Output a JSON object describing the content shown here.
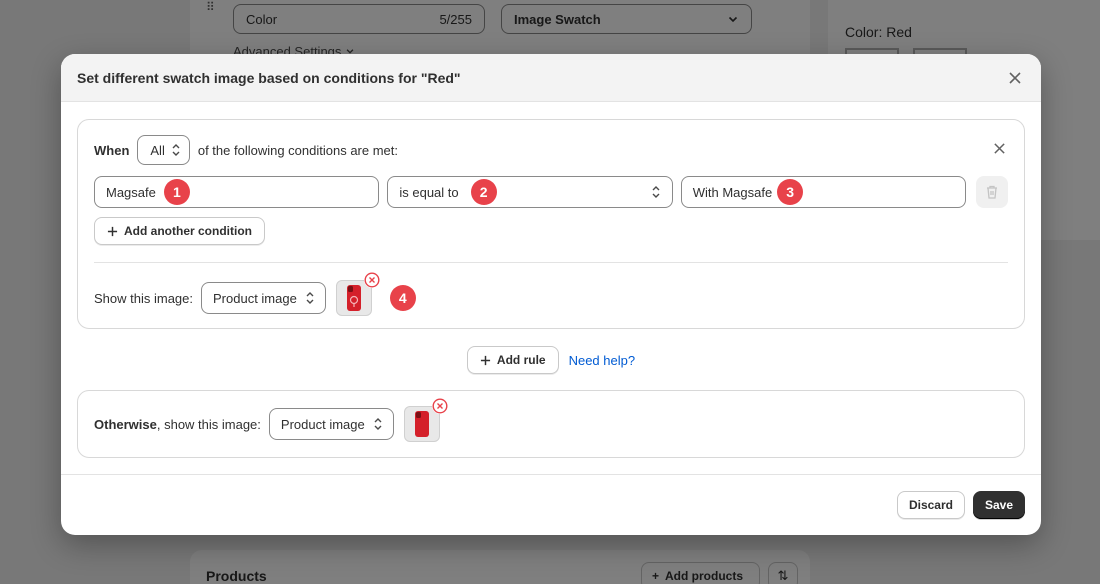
{
  "background": {
    "color_field_label": "Color",
    "color_field_count": "5/255",
    "swatch_type": "Image Swatch",
    "advanced_settings": "Advanced Settings",
    "color_preview_label": "Color: Red",
    "products_title": "Products",
    "add_products_label": "Add products"
  },
  "modal": {
    "title": "Set different swatch image based on conditions for \"Red\"",
    "rule": {
      "when_label": "When",
      "match_select": "All",
      "conditions_suffix": "of the following conditions are met:",
      "condition": {
        "field": "Magsafe",
        "operator": "is equal to",
        "value": "With Magsafe"
      },
      "badges": [
        "1",
        "2",
        "3",
        "4"
      ],
      "add_condition_label": "Add another condition",
      "show_image_label": "Show this image:",
      "image_source": "Product image"
    },
    "add_rule_label": "Add rule",
    "need_help_label": "Need help?",
    "otherwise": {
      "bold": "Otherwise",
      "rest": ", show this image:",
      "image_source": "Product image"
    },
    "footer": {
      "discard_label": "Discard",
      "save_label": "Save"
    }
  },
  "colors": {
    "badge": "#e8424a",
    "link": "#005bd3",
    "primary_button": "#303030",
    "phone_red": "#d4202a"
  }
}
